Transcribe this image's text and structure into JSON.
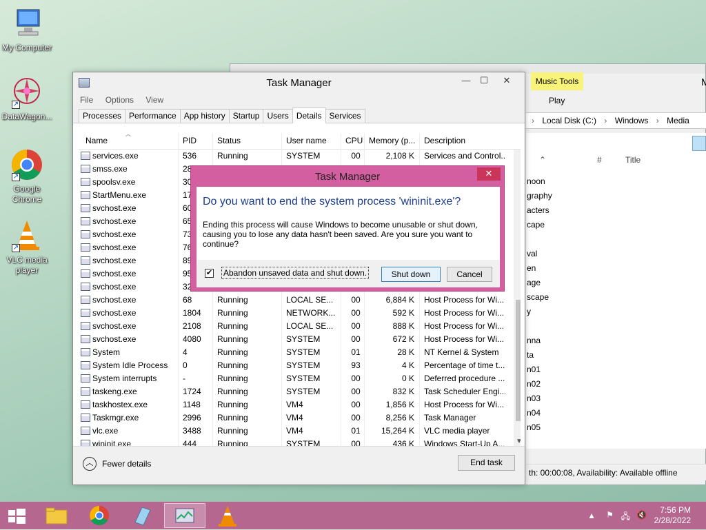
{
  "desktop": {
    "icons": [
      {
        "label": "My Computer",
        "icon": "computer-icon"
      },
      {
        "label": "DataWagon...",
        "icon": "datawagon-icon"
      },
      {
        "label": "Google Chrome",
        "icon": "chrome-icon"
      },
      {
        "label": "VLC media player",
        "icon": "vlc-icon"
      }
    ]
  },
  "background_window": {
    "music_tools": "Music Tools",
    "play": "Play",
    "address": [
      "Local Disk (C:)",
      "Windows",
      "Media"
    ],
    "columns": [
      "#",
      "Title"
    ],
    "rows": [
      "noon",
      "graphy",
      "acters",
      "cape",
      "val",
      "en",
      "age",
      "scape",
      "y",
      "nna",
      "ta",
      "n01",
      "n02",
      "n03",
      "n04",
      "n05"
    ],
    "status": "th: 00:00:08, Availability: Available offline"
  },
  "task_manager": {
    "title": "Task Manager",
    "menu": [
      "File",
      "Options",
      "View"
    ],
    "tabs": [
      "Processes",
      "Performance",
      "App history",
      "Startup",
      "Users",
      "Details",
      "Services"
    ],
    "active_tab": "Details",
    "columns": [
      "Name",
      "PID",
      "Status",
      "User name",
      "CPU",
      "Memory (p...",
      "Description"
    ],
    "rows": [
      [
        "services.exe",
        "536",
        "Running",
        "SYSTEM",
        "00",
        "2,108 K",
        "Services and Control..."
      ],
      [
        "smss.exe",
        "28",
        "",
        "",
        "",
        "",
        ""
      ],
      [
        "spoolsv.exe",
        "30",
        "",
        "",
        "",
        "",
        ""
      ],
      [
        "StartMenu.exe",
        "17",
        "",
        "",
        "",
        "",
        ""
      ],
      [
        "svchost.exe",
        "60",
        "",
        "",
        "",
        "",
        ""
      ],
      [
        "svchost.exe",
        "65",
        "",
        "",
        "",
        "",
        ""
      ],
      [
        "svchost.exe",
        "73",
        "",
        "",
        "",
        "",
        ""
      ],
      [
        "svchost.exe",
        "76",
        "",
        "",
        "",
        "",
        ""
      ],
      [
        "svchost.exe",
        "89",
        "",
        "",
        "",
        "",
        ""
      ],
      [
        "svchost.exe",
        "95",
        "",
        "",
        "",
        "",
        ""
      ],
      [
        "svchost.exe",
        "32",
        "",
        "",
        "",
        "",
        ""
      ],
      [
        "svchost.exe",
        "68",
        "Running",
        "LOCAL SE...",
        "00",
        "6,884 K",
        "Host Process for Wi..."
      ],
      [
        "svchost.exe",
        "1804",
        "Running",
        "NETWORK...",
        "00",
        "592 K",
        "Host Process for Wi..."
      ],
      [
        "svchost.exe",
        "2108",
        "Running",
        "LOCAL SE...",
        "00",
        "888 K",
        "Host Process for Wi..."
      ],
      [
        "svchost.exe",
        "4080",
        "Running",
        "SYSTEM",
        "00",
        "672 K",
        "Host Process for Wi..."
      ],
      [
        "System",
        "4",
        "Running",
        "SYSTEM",
        "01",
        "28 K",
        "NT Kernel & System"
      ],
      [
        "System Idle Process",
        "0",
        "Running",
        "SYSTEM",
        "93",
        "4 K",
        "Percentage of time t..."
      ],
      [
        "System interrupts",
        "-",
        "Running",
        "SYSTEM",
        "00",
        "0 K",
        "Deferred procedure ..."
      ],
      [
        "taskeng.exe",
        "1724",
        "Running",
        "SYSTEM",
        "00",
        "832 K",
        "Task Scheduler Engi..."
      ],
      [
        "taskhostex.exe",
        "1148",
        "Running",
        "VM4",
        "00",
        "1,856 K",
        "Host Process for Wi..."
      ],
      [
        "Taskmgr.exe",
        "2996",
        "Running",
        "VM4",
        "00",
        "8,256 K",
        "Task Manager"
      ],
      [
        "vlc.exe",
        "3488",
        "Running",
        "VM4",
        "01",
        "15,264 K",
        "VLC media player"
      ],
      [
        "wininit.exe",
        "444",
        "Running",
        "SYSTEM",
        "00",
        "436 K",
        "Windows Start-Up A..."
      ]
    ],
    "fewer_details": "Fewer details",
    "end_task": "End task"
  },
  "dialog": {
    "title": "Task Manager",
    "close": "✕",
    "question": "Do you want to end the system process 'wininit.exe'?",
    "message": "Ending this process will cause Windows to become unusable or shut down, causing you to lose any data hasn't been saved. Are you sure you want to continue?",
    "checkbox_label": "Abandon unsaved data and shut down.",
    "checkbox_checked": true,
    "shutdown_button": "Shut down",
    "cancel_button": "Cancel"
  },
  "taskbar": {
    "items": [
      "start-button",
      "file-explorer",
      "chrome",
      "notepad",
      "task-manager",
      "vlc"
    ],
    "time": "7:56 PM",
    "date": "2/28/2022"
  }
}
